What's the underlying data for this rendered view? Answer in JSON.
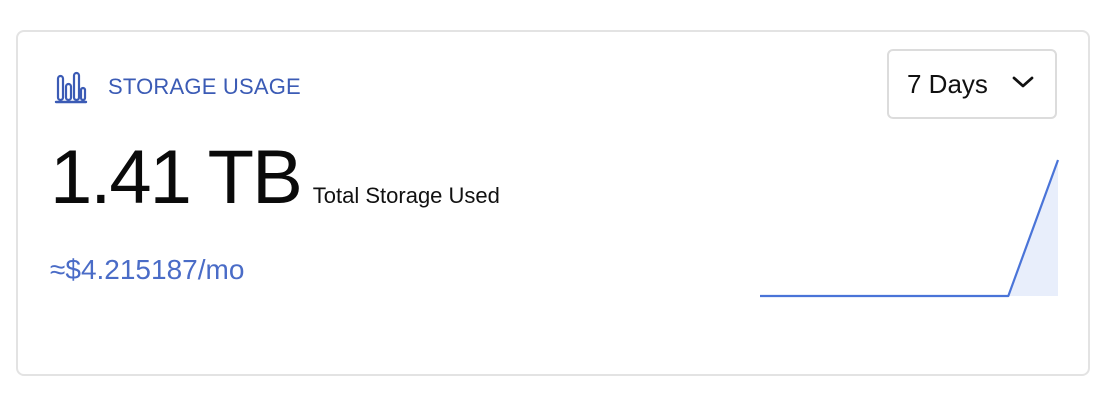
{
  "card": {
    "title": "STORAGE USAGE",
    "title_icon": "bar-chart-icon",
    "range": {
      "selected": "7 Days",
      "chevron_icon": "chevron-down-icon"
    },
    "metric": {
      "value": "1.41 TB",
      "caption": "Total Storage Used"
    },
    "cost": "≈$4.215187/mo"
  },
  "colors": {
    "accent": "#3b5bb5",
    "cost": "#4a6cc7",
    "sparkline_line": "#4a74d8",
    "sparkline_fill": "#e8eefb",
    "border": "#e3e3e3"
  },
  "chart_data": {
    "type": "area",
    "x": [
      1,
      2,
      3,
      4,
      5,
      6,
      7
    ],
    "values": [
      0.0,
      0.0,
      0.0,
      0.0,
      0.0,
      0.0,
      1.41
    ],
    "ylim": [
      0,
      1.41
    ],
    "grid": false
  }
}
